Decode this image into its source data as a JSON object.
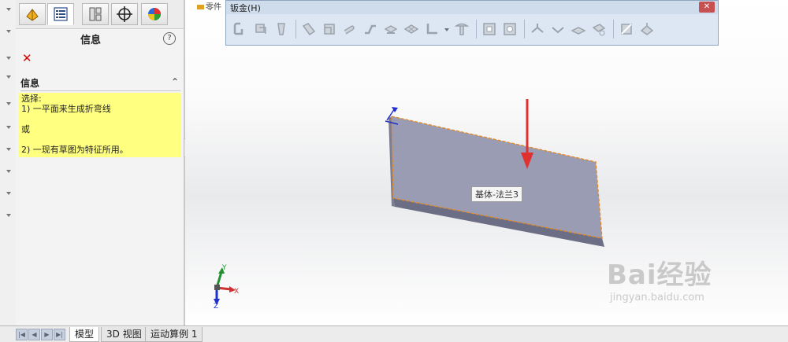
{
  "panel": {
    "title": "信息",
    "help_symbol": "?",
    "cancel_symbol": "✕",
    "section_title": "信息",
    "collapse_symbol": "⌃",
    "info_lines": [
      "选择:",
      "1) 一平面来生成折弯线",
      "",
      "或",
      "",
      "2) 一现有草图为特征所用。"
    ]
  },
  "tree": {
    "top_text": "零件"
  },
  "toolbar": {
    "title": "钣金(H)",
    "close_symbol": "✕"
  },
  "model": {
    "feature_label": "基体-法兰3"
  },
  "triad": {
    "x": "X",
    "y": "Y",
    "z": "Z"
  },
  "bottom_tabs": [
    "模型",
    "3D 视图",
    "运动算例 1"
  ],
  "watermark": {
    "main": "Bai经验",
    "sub": "jingyan.baidu.com"
  },
  "colors": {
    "info_bg": "#ffff80",
    "model_face": "#9a9cb3",
    "edge_orange": "#e08a2c",
    "arrow_red": "#e03030"
  }
}
